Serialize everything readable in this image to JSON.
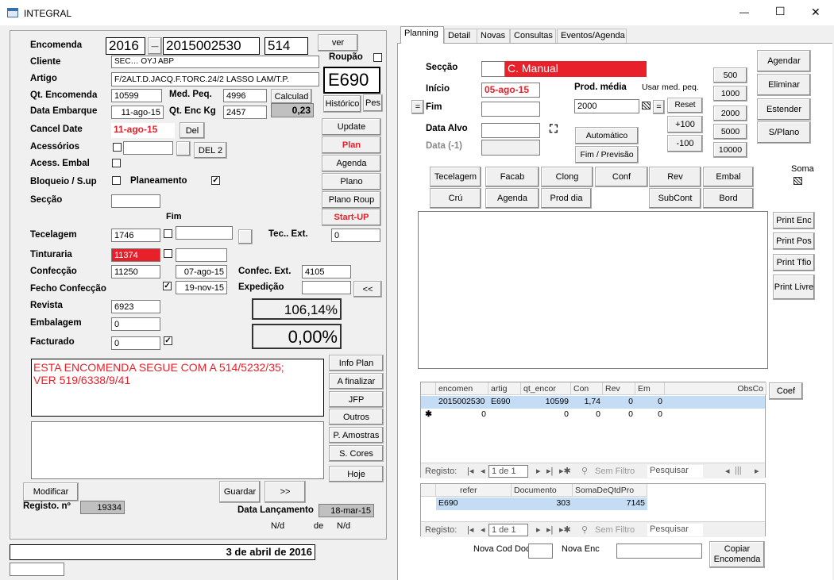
{
  "window": {
    "title": "INTEGRAL",
    "minimize": "—",
    "maximize": "☐",
    "close": "✕"
  },
  "left": {
    "encomenda_label": "Encomenda",
    "enc_year": "2016",
    "enc_dash": "—",
    "enc_number": "2015002530",
    "enc_code": "514",
    "ver_button": "ver",
    "roupao_label": "Roupão",
    "cliente_label": "Cliente",
    "cliente_value": "SEC…          OYJ ABP",
    "artigo_label": "Artigo",
    "artigo_value": "F/2ALT.D.JACQ.F.TORC.24/2 LASSO LAM/T.P.",
    "artigo_code": "E690",
    "qt_encomenda_label": "Qt. Encomenda",
    "qt_encomenda_value": "10599",
    "med_peq_label": "Med. Peq.",
    "med_peq_value": "4996",
    "calculad_button": "Calculad",
    "data_embarque_label": "Data Embarque",
    "data_embarque_value": "11-ago-15",
    "qt_enc_kg_label": "Qt. Enc Kg",
    "qt_enc_kg_value": "2457",
    "ratio_value": "0,23",
    "historico_button": "Histórico",
    "pes_button": "Pes",
    "cancel_date_label": "Cancel Date",
    "cancel_date_value": "11-ago-15",
    "del_button": "Del",
    "acessorios_label": "Acessórios",
    "del2_button": "DEL 2",
    "acess_embal_label": "Acess. Embal",
    "bloqueio_label": "Bloqueio / S.up",
    "planeamento_label": "Planeamento",
    "seccao_label": "Secção",
    "fim_label": "Fim",
    "tecelagem_label": "Tecelagem",
    "tecelagem_value": "1746",
    "tec_ext_label": "Tec.. Ext.",
    "tec_ext_value": "0",
    "tinturaria_label": "Tinturaria",
    "tinturaria_value": "11374",
    "confeccao_label": "Confecção",
    "confeccao_value": "11250",
    "confeccao_date": "07-ago-15",
    "confec_ext_label": "Confec. Ext.",
    "confec_ext_value": "4105",
    "fecho_label": "Fecho Confecção",
    "fecho_date": "19-nov-15",
    "expedicao_label": "Expedição",
    "back_button": "<<",
    "revista_label": "Revista",
    "revista_value": "6923",
    "pct1": "106,14%",
    "embalagem_label": "Embalagem",
    "embalagem_value": "0",
    "pct2": "0,00%",
    "facturado_label": "Facturado",
    "facturado_value": "0",
    "notes": "ESTA ENCOMENDA SEGUE COM A 514/5232/35;\nVER 519/6338/9/41",
    "modificar_button": "Modificar",
    "guardar_button": "Guardar",
    "next_button": ">>",
    "registo_label": "Registo. nº",
    "registo_value": "19334",
    "data_lancamento_label": "Data Lançamento",
    "data_lancamento_value": "18-mar-15",
    "nd1": "N/d",
    "de": "de",
    "nd2": "N/d",
    "footer_date": "3 de abril de 2016"
  },
  "side_buttons": [
    "Update",
    "Plan",
    "Agenda",
    "Plano",
    "Plano Roup",
    "Start-UP"
  ],
  "info_buttons": [
    "Info Plan",
    "A finalizar",
    "JFP",
    "Outros",
    "P. Amostras",
    "S. Cores",
    "Hoje"
  ],
  "tabs": [
    "Planning",
    "Detail",
    "Novas",
    "Consultas",
    "Eventos/Agenda"
  ],
  "planning": {
    "seccao_label": "Secção",
    "seccao_value": "C. Manual",
    "inicio_label": "Início",
    "inicio_value": "05-ago-15",
    "prod_media_label": "Prod. média",
    "usar_med_label": "Usar med. peq.",
    "prod_media_value": "2000",
    "reset_button": "Reset",
    "eq_button": "=",
    "fim_label": "Fim",
    "data_alvo_label": "Data Alvo",
    "data_menos1_label": "Data (-1)",
    "automatico_button": "Automático",
    "fim_previsao_button": "Fim / Previsão",
    "plus100_button": "+100",
    "minus100_button": "-100",
    "qty_buttons": [
      "500",
      "1000",
      "2000",
      "5000",
      "10000"
    ],
    "right_buttons": [
      "Agendar",
      "Eliminar",
      "Estender",
      "S/Plano"
    ],
    "soma_label": "Soma",
    "row1_buttons": [
      "Tecelagem",
      "Facab",
      "Clong",
      "Conf",
      "Rev",
      "Embal"
    ],
    "row2_buttons": [
      "Crú",
      "Agenda",
      "Prod  dia",
      "SubCont",
      "Bord"
    ],
    "print_buttons": [
      "Print Enc",
      "Print Pos",
      "Print Tfio",
      "Print Livre"
    ],
    "coef_button": "Coef",
    "grid1": {
      "headers": [
        "encomen",
        "artig",
        "qt_encor",
        "Con",
        "Rev",
        "Em",
        "ObsCo"
      ],
      "rows": [
        [
          "2015002530",
          "E690",
          "10599",
          "1,74",
          "0",
          "0"
        ],
        [
          "0",
          "",
          "0",
          "0",
          "0",
          "0"
        ]
      ]
    },
    "grid2": {
      "headers": [
        "refer",
        "Documento",
        "SomaDeQtdPro"
      ],
      "rows": [
        [
          "E690",
          "303",
          "7145"
        ]
      ]
    },
    "nav": {
      "registo": "Registo:",
      "pos": "1 de 1",
      "sem_filtro": "Sem Filtro",
      "pesquisar": "Pesquisar"
    },
    "nova_cod_doc_label": "Nova Cod Doc",
    "nova_enc_label": "Nova Enc",
    "copiar_button": "Copiar Encomenda"
  }
}
